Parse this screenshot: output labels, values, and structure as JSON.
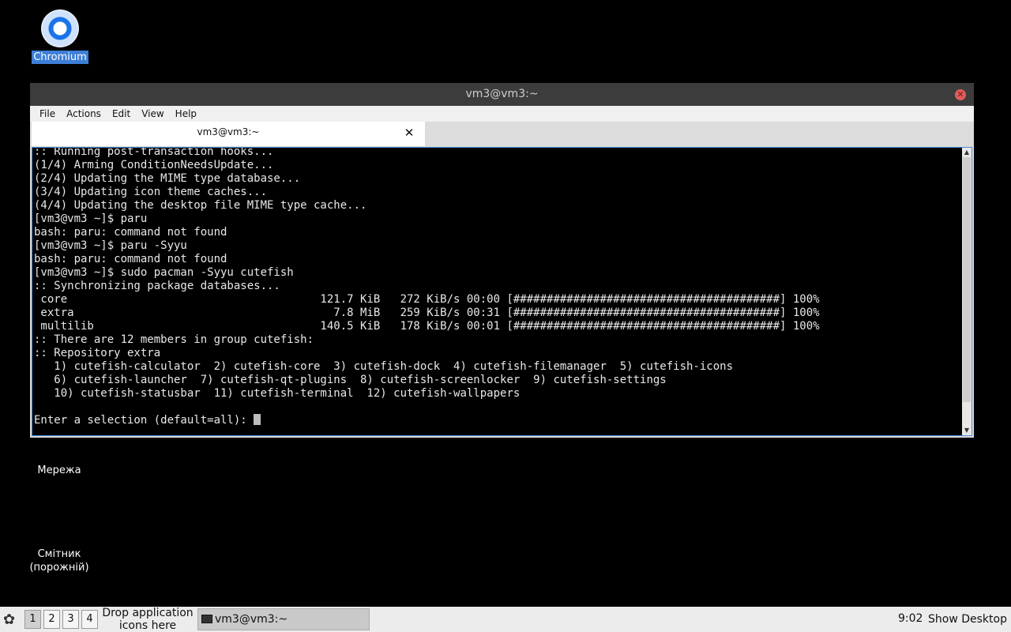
{
  "desktop": {
    "icons": [
      {
        "label": "Chromium"
      },
      {
        "label": "Мережа"
      },
      {
        "label": "Смітник\n(порожній)",
        "line1": "Смітник",
        "line2": "(порожній)"
      }
    ]
  },
  "window": {
    "title": "vm3@vm3:~",
    "menu": [
      "File",
      "Actions",
      "Edit",
      "View",
      "Help"
    ],
    "tab_label": "vm3@vm3:~",
    "terminal_lines": [
      ":: Running post-transaction hooks...",
      "(1/4) Arming ConditionNeedsUpdate...",
      "(2/4) Updating the MIME type database...",
      "(3/4) Updating icon theme caches...",
      "(4/4) Updating the desktop file MIME type cache...",
      "[vm3@vm3 ~]$ paru",
      "bash: paru: command not found",
      "[vm3@vm3 ~]$ paru -Syyu",
      "bash: paru: command not found",
      "[vm3@vm3 ~]$ sudo pacman -Syyu cutefish",
      ":: Synchronizing package databases...",
      " core                                      121.7 KiB   272 KiB/s 00:00 [########################################] 100%",
      " extra                                       7.8 MiB   259 KiB/s 00:31 [########################################] 100%",
      " multilib                                  140.5 KiB   178 KiB/s 00:01 [########################################] 100%",
      ":: There are 12 members in group cutefish:",
      ":: Repository extra",
      "   1) cutefish-calculator  2) cutefish-core  3) cutefish-dock  4) cutefish-filemanager  5) cutefish-icons",
      "   6) cutefish-launcher  7) cutefish-qt-plugins  8) cutefish-screenlocker  9) cutefish-settings",
      "   10) cutefish-statusbar  11) cutefish-terminal  12) cutefish-wallpapers",
      "",
      "Enter a selection (default=all): "
    ]
  },
  "taskbar": {
    "workspaces": [
      "1",
      "2",
      "3",
      "4"
    ],
    "drop_line1": "Drop application",
    "drop_line2": "icons here",
    "task_label": "vm3@vm3:~",
    "clock": "9:02",
    "show_desktop": "Show Desktop"
  },
  "icons": {
    "start": "start-menu-icon",
    "close": "close-icon",
    "tab_close": "close-icon",
    "terminal": "terminal-icon"
  }
}
